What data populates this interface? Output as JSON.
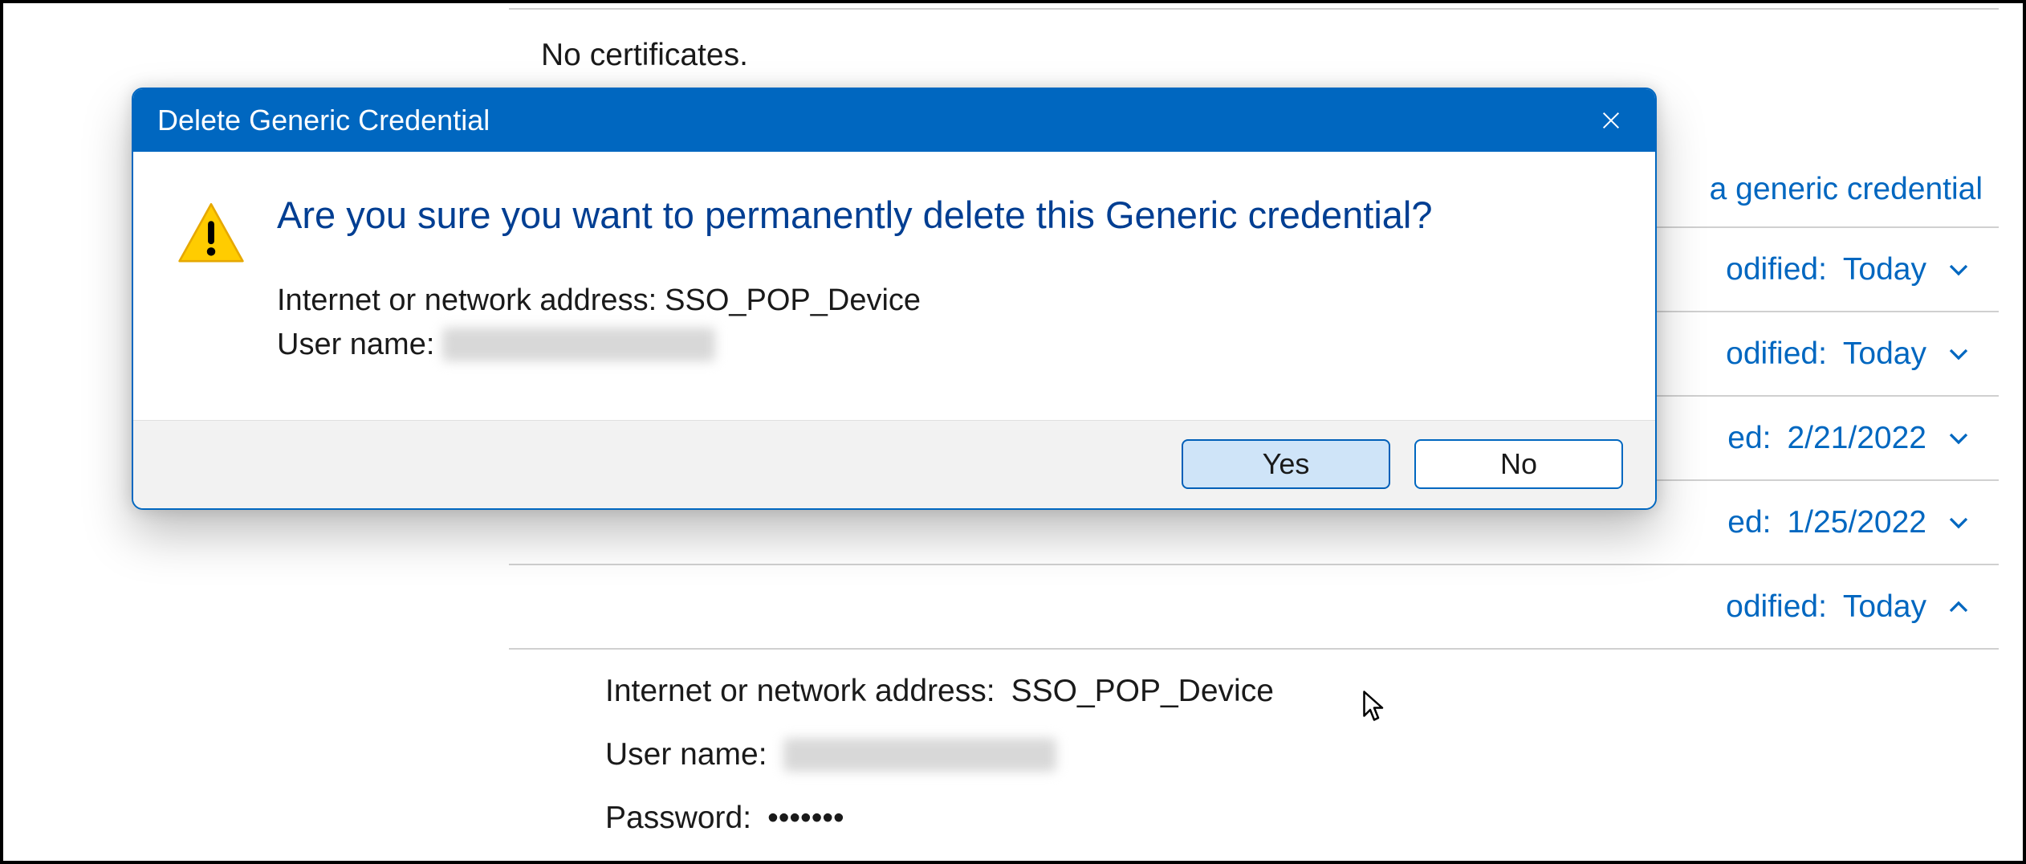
{
  "background": {
    "no_certificates": "No certificates.",
    "add_generic_link": "a generic credential",
    "rows": [
      {
        "label": "odified:",
        "value": "Today",
        "expanded": false
      },
      {
        "label": "odified:",
        "value": "Today",
        "expanded": false
      },
      {
        "label": "ed:",
        "value": "2/21/2022",
        "expanded": false
      },
      {
        "label": "ed:",
        "value": "1/25/2022",
        "expanded": false
      },
      {
        "label": "odified:",
        "value": "Today",
        "expanded": true
      }
    ],
    "expanded": {
      "address_label": "Internet or network address:",
      "address_value": "SSO_POP_Device",
      "username_label": "User name:",
      "username_value": "",
      "password_label": "Password:",
      "password_value": "•••••••"
    }
  },
  "dialog": {
    "title": "Delete Generic Credential",
    "headline": "Are you sure you want to permanently delete this Generic credential?",
    "address_label": "Internet or network address:",
    "address_value": "SSO_POP_Device",
    "username_label": "User name:",
    "username_value": "",
    "yes": "Yes",
    "no": "No"
  }
}
